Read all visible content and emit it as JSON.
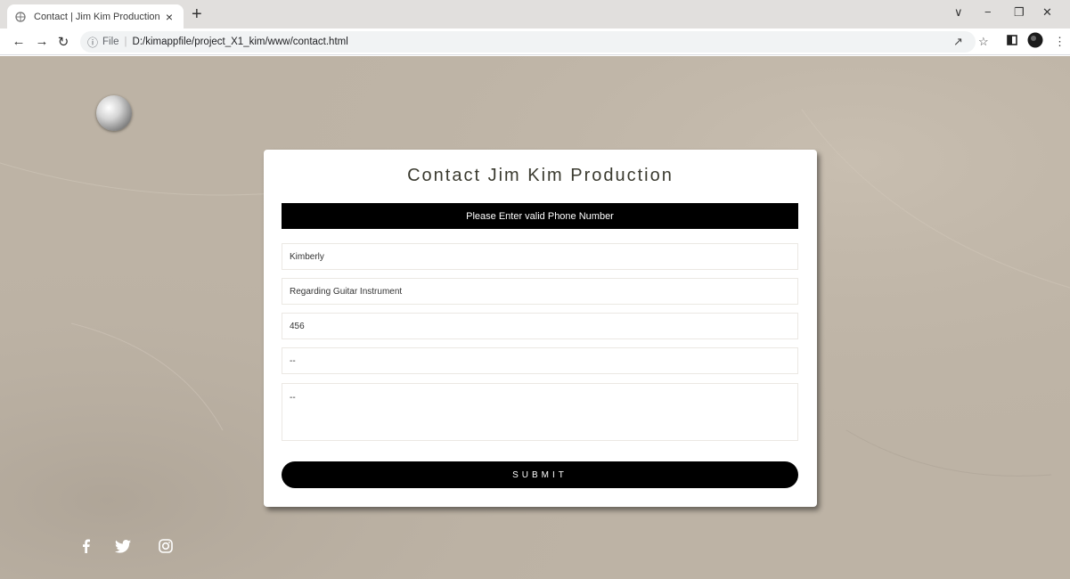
{
  "browser": {
    "tab_title": "Contact | Jim Kim Production",
    "tab_close": "×",
    "new_tab": "+",
    "url_scheme": "File",
    "url_sep": "|",
    "url_path": "D:/kimappfile/project_X1_kim/www/contact.html",
    "window_controls": [
      "∨",
      "−",
      "❐",
      "✕"
    ]
  },
  "page": {
    "contact_title": "Contact Jim Kim Production",
    "alert": "Please Enter valid Phone Number",
    "fields": {
      "name": "Kimberly",
      "subject": "Regarding Guitar Instrument",
      "phone": "456",
      "email": "--",
      "message": "--"
    },
    "submit_label": "SUBMIT",
    "social": [
      "facebook-icon",
      "twitter-icon",
      "instagram-icon"
    ]
  }
}
